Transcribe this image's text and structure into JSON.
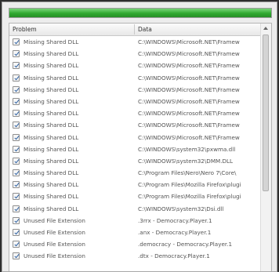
{
  "progress": {
    "value": 1.0
  },
  "columns": {
    "problem": "Problem",
    "data": "Data"
  },
  "rows": [
    {
      "problem": "Missing Shared DLL",
      "data": "C:\\WINDOWS\\Microsoft.NET\\Framew"
    },
    {
      "problem": "Missing Shared DLL",
      "data": "C:\\WINDOWS\\Microsoft.NET\\Framew"
    },
    {
      "problem": "Missing Shared DLL",
      "data": "C:\\WINDOWS\\Microsoft.NET\\Framew"
    },
    {
      "problem": "Missing Shared DLL",
      "data": "C:\\WINDOWS\\Microsoft.NET\\Framew"
    },
    {
      "problem": "Missing Shared DLL",
      "data": "C:\\WINDOWS\\Microsoft.NET\\Framew"
    },
    {
      "problem": "Missing Shared DLL",
      "data": "C:\\WINDOWS\\Microsoft.NET\\Framew"
    },
    {
      "problem": "Missing Shared DLL",
      "data": "C:\\WINDOWS\\Microsoft.NET\\Framew"
    },
    {
      "problem": "Missing Shared DLL",
      "data": "C:\\WINDOWS\\Microsoft.NET\\Framew"
    },
    {
      "problem": "Missing Shared DLL",
      "data": "C:\\WINDOWS\\Microsoft.NET\\Framew"
    },
    {
      "problem": "Missing Shared DLL",
      "data": "C:\\WINDOWS\\system32\\pxwma.dll"
    },
    {
      "problem": "Missing Shared DLL",
      "data": "C:\\WINDOWS\\system32\\DMM.DLL"
    },
    {
      "problem": "Missing Shared DLL",
      "data": "C:\\Program Files\\Nero\\Nero 7\\Core\\"
    },
    {
      "problem": "Missing Shared DLL",
      "data": "C:\\Program Files\\Mozilla Firefox\\plugi"
    },
    {
      "problem": "Missing Shared DLL",
      "data": "C:\\Program Files\\Mozilla Firefox\\plugi"
    },
    {
      "problem": "Missing Shared DLL",
      "data": "C:\\WINDOWS\\system32\\Dsi.dll"
    },
    {
      "problem": "Unused File Extension",
      "data": ".3rrx - Democracy.Player.1"
    },
    {
      "problem": "Unused File Extension",
      "data": ".anx - Democracy.Player.1"
    },
    {
      "problem": "Unused File Extension",
      "data": ".democracy - Democracy.Player.1"
    },
    {
      "problem": "Unused File Extension",
      "data": ".dtx - Democracy.Player.1"
    }
  ]
}
